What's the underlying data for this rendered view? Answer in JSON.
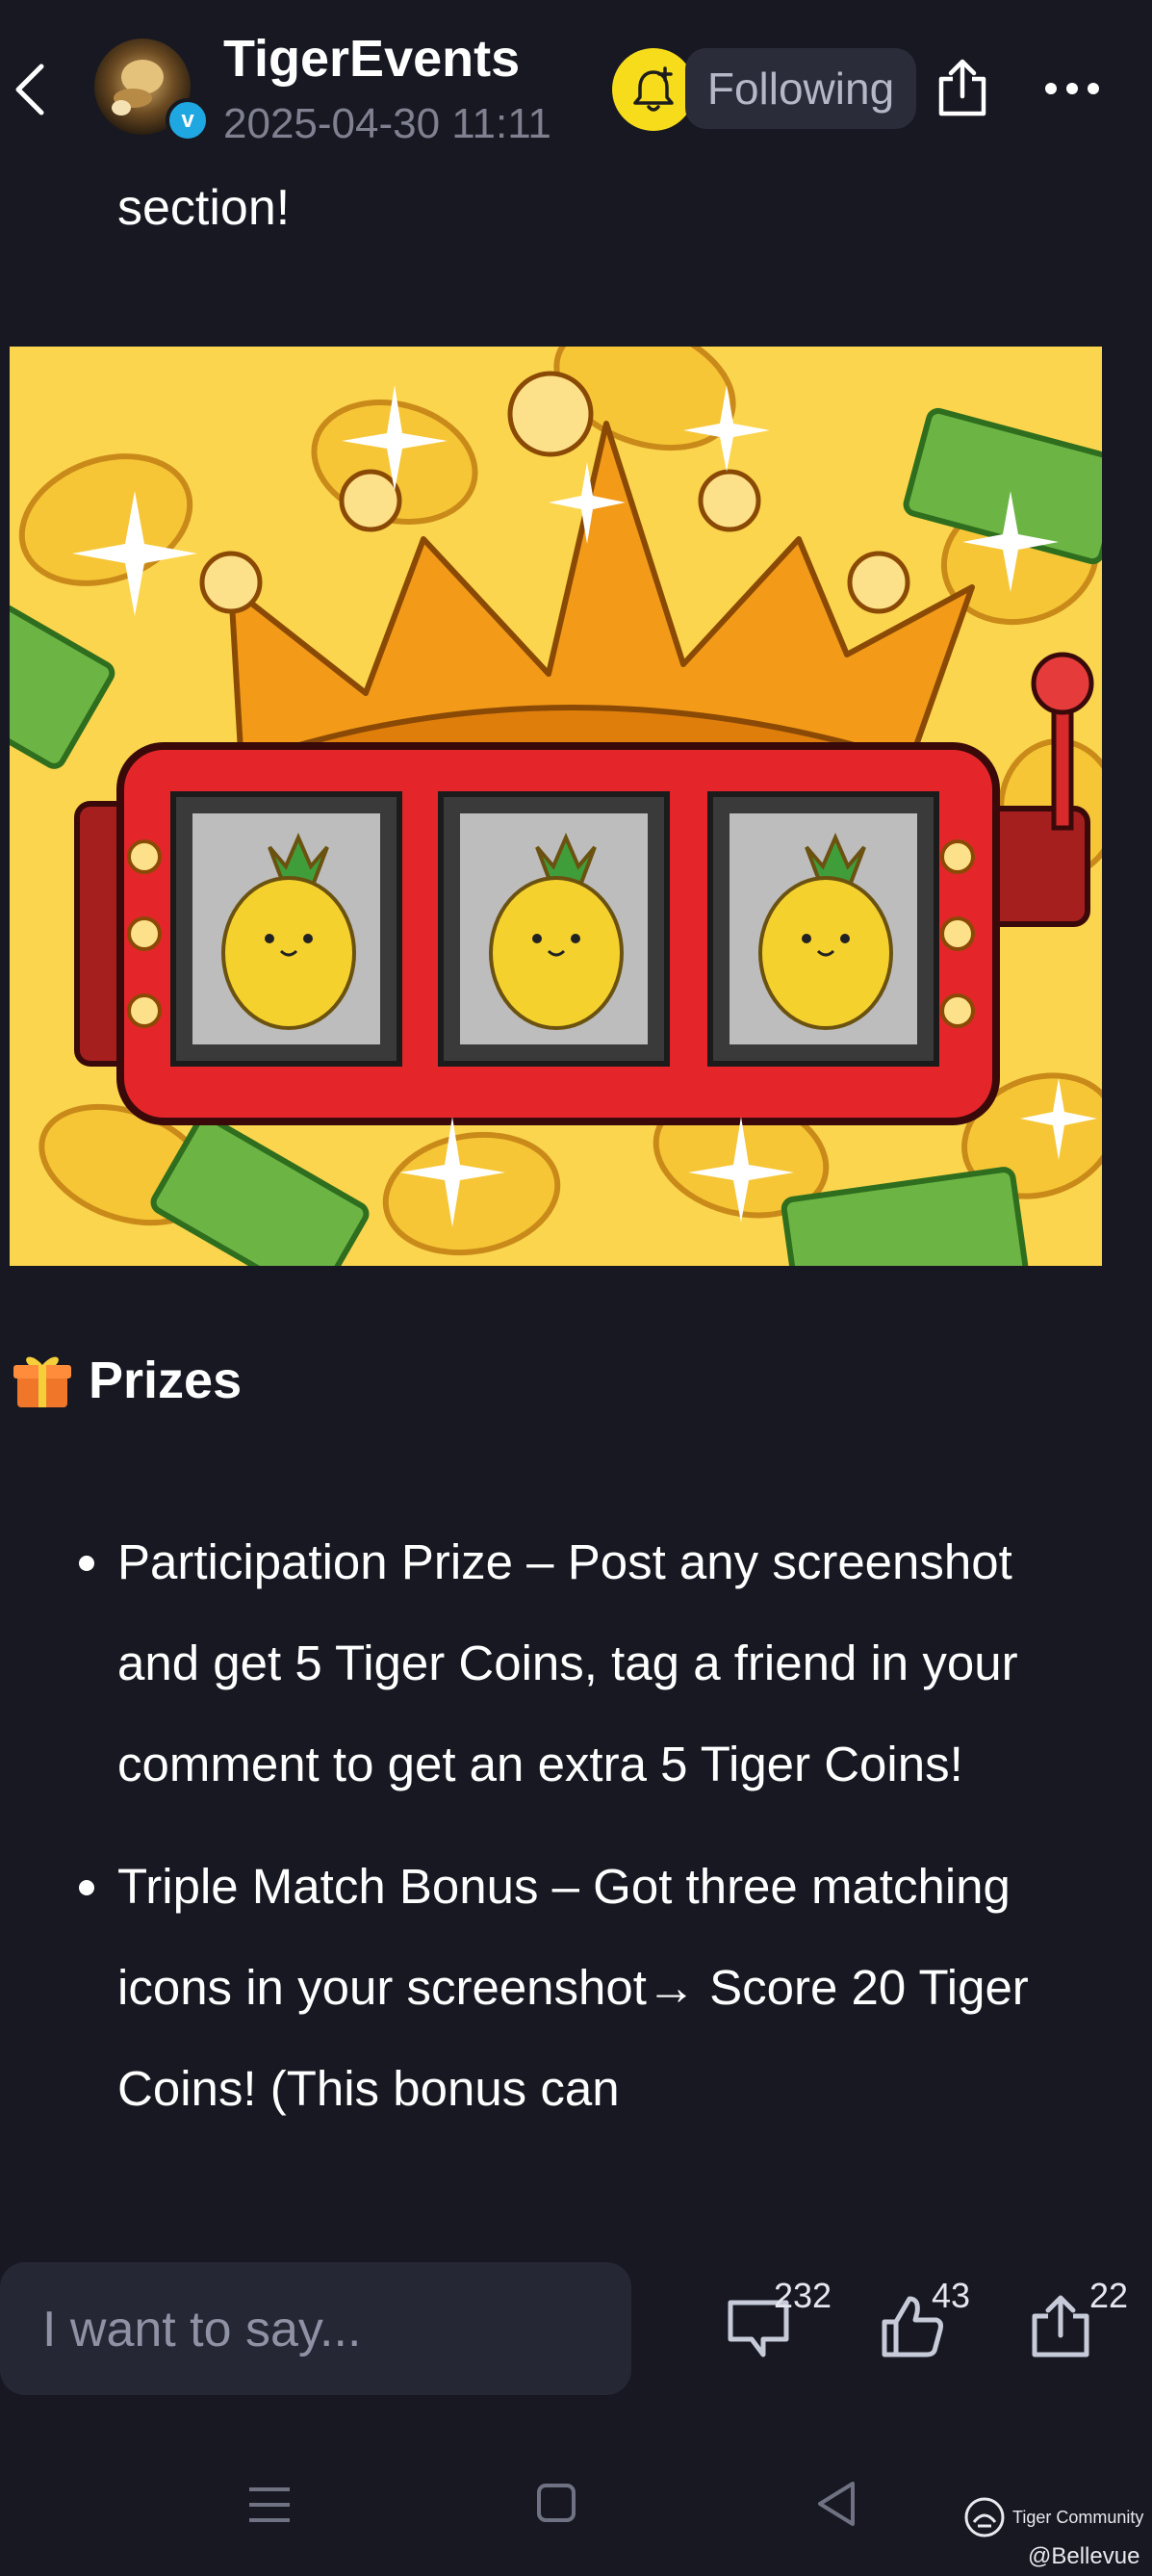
{
  "header": {
    "author": "TigerEvents",
    "date": "2025-04-30 11:11",
    "verified_badge": "v",
    "follow_label": "Following"
  },
  "post": {
    "section_text": "section!",
    "image_alt": "slot-machine-with-crown-pineapples-coins",
    "prizes_title": "Prizes",
    "bullets": [
      "Participation Prize – Post any screenshot and get 5 Tiger Coins, tag a friend in your comment to get an extra 5 Tiger Coins!",
      "Triple Match Bonus – Got three matching icons in your screenshot→ Score 20 Tiger Coins! (This bonus can"
    ]
  },
  "bottom_bar": {
    "input_placeholder": "I want to say...",
    "comments_count": "232",
    "likes_count": "43",
    "shares_count": "22"
  },
  "watermark": {
    "brand": "Tiger Community",
    "handle": "@Bellevue"
  },
  "colors": {
    "background": "#171822",
    "bell": "#f6dc1a",
    "follow_button": "#2a2c3a",
    "muted_text": "#7f8190",
    "input_bg": "#252735"
  }
}
